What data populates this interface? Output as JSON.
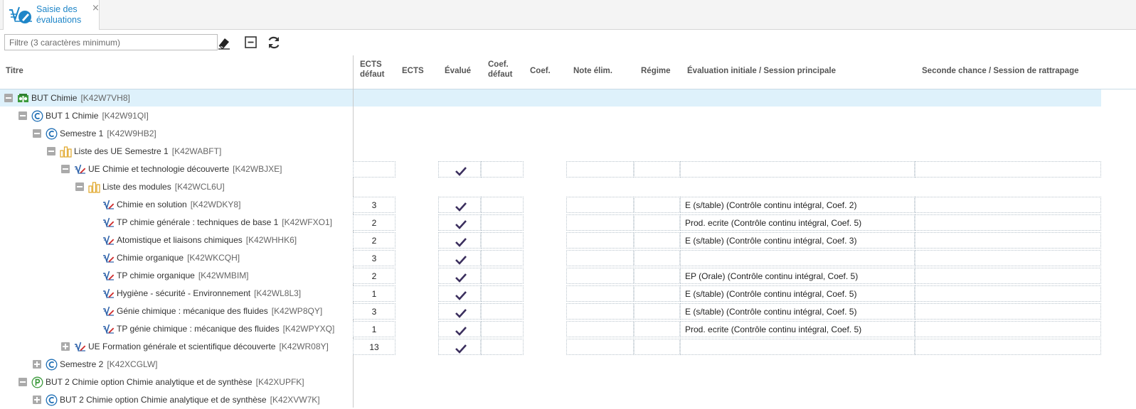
{
  "tab": {
    "label": "Saisie des évaluations",
    "close": "×"
  },
  "toolbar": {
    "filter_placeholder": "Filtre (3 caractères minimum)"
  },
  "columns": {
    "titre": "Titre",
    "ects_defaut": [
      "ECTS",
      "défaut"
    ],
    "ects": "ECTS",
    "evalue": "Évalué",
    "coef_defaut": [
      "Coef.",
      "défaut"
    ],
    "coef": "Coef.",
    "note_elim": "Note élim.",
    "regime": "Régime",
    "session_principale": "Évaluation initiale / Session principale",
    "session_rattrapage": "Seconde chance / Session de rattrapage"
  },
  "colors": {
    "accent": "#1f86c8",
    "check": "#3b2f5e",
    "highlight": "#def1fb"
  },
  "rows": [
    {
      "title": "BUT Chimie",
      "code": "[K42W7VH8]",
      "icon": "diploma-icon",
      "toggle": "minus"
    },
    {
      "title": "BUT 1 Chimie",
      "code": "[K42W91QI]",
      "icon": "course-c-icon",
      "toggle": "minus"
    },
    {
      "title": "Semestre 1",
      "code": "[K42W9HB2]",
      "icon": "course-c-icon",
      "toggle": "minus"
    },
    {
      "title": "Liste des UE Semestre 1",
      "code": "[K42WABFT]",
      "icon": "list-icon",
      "toggle": "minus"
    },
    {
      "title": "UE Chimie et technologie découverte",
      "code": "[K42WBJXE]",
      "icon": "ue-icon",
      "toggle": "minus",
      "ects": "",
      "evalue": true,
      "eval": ""
    },
    {
      "title": "Liste des modules",
      "code": "[K42WCL6U]",
      "icon": "list-icon",
      "toggle": "minus"
    },
    {
      "title": "Chimie en solution",
      "code": "[K42WDKY8]",
      "icon": "ue-icon",
      "ects": "3",
      "evalue": true,
      "eval": "E (s/table) (Contrôle continu intégral, Coef. 2)"
    },
    {
      "title": "TP chimie générale : techniques de base 1",
      "code": "[K42WFXO1]",
      "icon": "ue-icon",
      "ects": "2",
      "evalue": true,
      "eval": "Prod. ecrite (Contrôle continu intégral, Coef. 5)"
    },
    {
      "title": "Atomistique et liaisons chimiques",
      "code": "[K42WHHK6]",
      "icon": "ue-icon",
      "ects": "2",
      "evalue": true,
      "eval": "E (s/table) (Contrôle continu intégral, Coef. 3)"
    },
    {
      "title": "Chimie organique",
      "code": "[K42WKCQH]",
      "icon": "ue-icon",
      "ects": "3",
      "evalue": true,
      "eval": ""
    },
    {
      "title": "TP chimie organique",
      "code": "[K42WMBIM]",
      "icon": "ue-icon",
      "ects": "2",
      "evalue": true,
      "eval": "EP (Orale) (Contrôle continu intégral, Coef. 5)"
    },
    {
      "title": "Hygiène - sécurité - Environnement",
      "code": "[K42WL8L3]",
      "icon": "ue-icon",
      "ects": "1",
      "evalue": true,
      "eval": "E (s/table) (Contrôle continu intégral, Coef. 5)"
    },
    {
      "title": "Génie chimique : mécanique des fluides",
      "code": "[K42WP8QY]",
      "icon": "ue-icon",
      "ects": "3",
      "evalue": true,
      "eval": "E (s/table) (Contrôle continu intégral, Coef. 5)"
    },
    {
      "title": "TP génie chimique : mécanique des fluides",
      "code": "[K42WPYXQ]",
      "icon": "ue-icon",
      "ects": "1",
      "evalue": true,
      "eval": "Prod. ecrite (Contrôle continu intégral, Coef. 5)"
    },
    {
      "title": "UE Formation générale et scientifique découverte",
      "code": "[K42WR08Y]",
      "icon": "ue-icon",
      "toggle": "plus",
      "ects": "13",
      "evalue": true,
      "eval": ""
    },
    {
      "title": "Semestre 2",
      "code": "[K42XCGLW]",
      "icon": "course-c-icon",
      "toggle": "plus"
    },
    {
      "title": "BUT 2 Chimie option Chimie analytique et de synthèse",
      "code": "[K42XUPFK]",
      "icon": "course-p-icon",
      "toggle": "minus"
    },
    {
      "title": "BUT 2 Chimie option Chimie analytique et de synthèse",
      "code": "[K42XVW7K]",
      "icon": "course-c-icon",
      "toggle": "plus"
    }
  ]
}
